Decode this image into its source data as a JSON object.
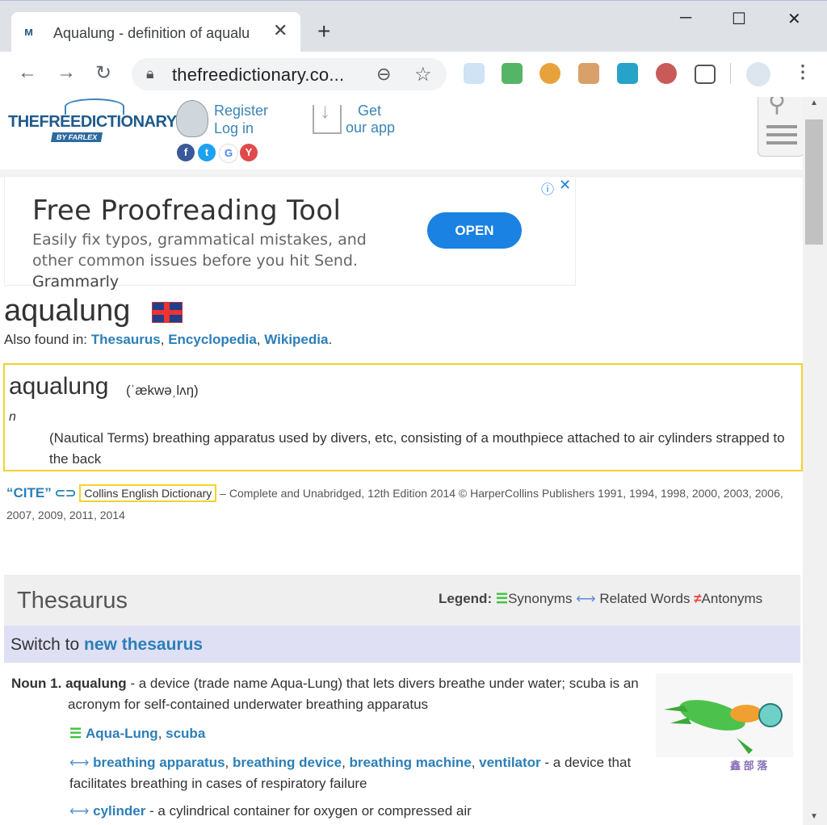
{
  "browser": {
    "tab_title": "Aqualung - definition of aqualu",
    "tab_favicon": "ᴍ",
    "new_tab": "+",
    "url": "thefreedictionary.co...",
    "window_buttons": [
      "─",
      "☐",
      "✕"
    ]
  },
  "site": {
    "logo_main": "THEFREEDICTIONARY",
    "logo_sub": "BY FARLEX",
    "register": "Register",
    "login": "Log in",
    "get": "Get",
    "our_app": "our app",
    "social": [
      "f",
      "t",
      "G",
      "Y"
    ]
  },
  "ad": {
    "title": "Free Proofreading Tool",
    "text": "Easily fix typos, grammatical mistakes, and other common issues before you hit Send.",
    "brand": "Grammarly",
    "button": "OPEN"
  },
  "entry": {
    "word": "aqualung",
    "also_found_in": "Also found in:",
    "links": [
      "Thesaurus",
      "Encyclopedia",
      "Wikipedia"
    ],
    "def_word": "aqualung",
    "pronunciation": "(ˈækwəˌlʌŋ)",
    "pos": "n",
    "definition": "(Nautical Terms) breathing apparatus used by divers, etc, consisting of a mouthpiece attached to air cylinders strapped to the back",
    "cite": "“CITE”",
    "source": "Collins English Dictionary",
    "source_rest": "– Complete and Unabridged, 12th Edition 2014 © HarperCollins Publishers 1991, 1994, 1998, 2000, 2003, 2006, 2007, 2009, 2011, 2014"
  },
  "thesaurus": {
    "title": "Thesaurus",
    "legend_label": "Legend:",
    "synonyms": "Synonyms",
    "related": "Related Words",
    "antonyms": "Antonyms",
    "switch_text": "Switch to",
    "switch_link": "new thesaurus",
    "noun_label": "Noun 1.",
    "noun_word": "aqualung",
    "noun_def": "- a device (trade name Aqua-Lung) that lets divers breathe under water; scuba is an acronym for self-contained underwater breathing apparatus",
    "synonym_words": [
      "Aqua-Lung",
      "scuba"
    ],
    "related_1": [
      "breathing apparatus",
      "breathing device",
      "breathing machine",
      "ventilator"
    ],
    "related_1_def": "- a device that facilitates breathing in cases of respiratory failure",
    "related_2": "cylinder",
    "related_2_def": "- a cylindrical container for oxygen or compressed air",
    "watermark": "鑫 部 落"
  }
}
